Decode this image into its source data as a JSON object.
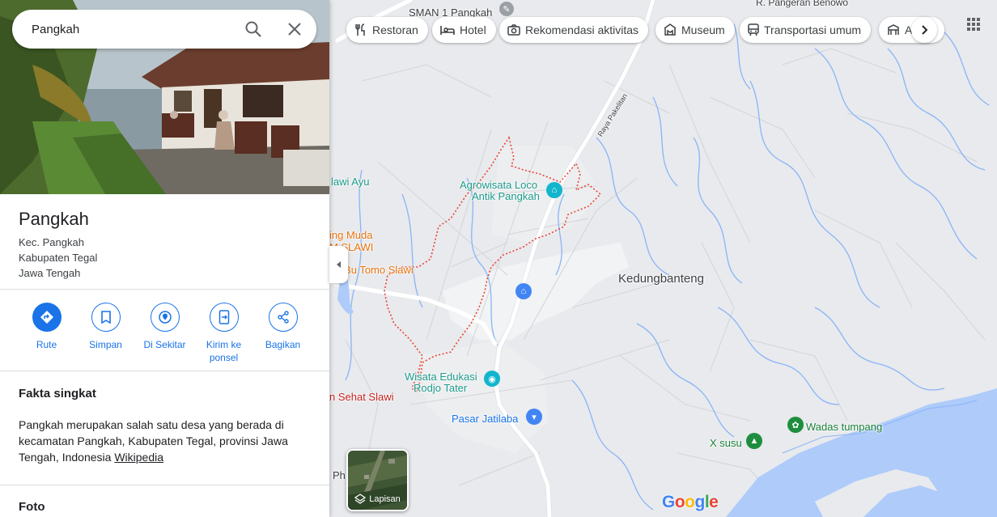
{
  "search": {
    "value": "Pangkah"
  },
  "place": {
    "title": "Pangkah",
    "address_lines": [
      "Kec. Pangkah",
      "Kabupaten Tegal",
      "Jawa Tengah"
    ]
  },
  "actions": [
    {
      "label": "Rute",
      "icon": "directions-icon"
    },
    {
      "label": "Simpan",
      "icon": "bookmark-icon"
    },
    {
      "label": "Di Sekitar",
      "icon": "nearby-icon"
    },
    {
      "label": "Kirim ke ponsel",
      "icon": "send-to-phone-icon"
    },
    {
      "label": "Bagikan",
      "icon": "share-icon"
    }
  ],
  "facts": {
    "title": "Fakta singkat",
    "text": "Pangkah merupakan salah satu desa yang berada di kecamatan Pangkah, Kabupaten Tegal, provinsi Jawa Tengah, Indonesia",
    "source": "Wikipedia"
  },
  "photos": {
    "title": "Foto"
  },
  "chips": [
    {
      "label": "Restoran",
      "icon": "restaurant-icon"
    },
    {
      "label": "Hotel",
      "icon": "hotel-icon"
    },
    {
      "label": "Rekomendasi aktivitas",
      "icon": "camera-icon"
    },
    {
      "label": "Museum",
      "icon": "museum-icon"
    },
    {
      "label": "Transportasi umum",
      "icon": "transit-icon"
    },
    {
      "label": "A",
      "icon": "attraction-icon"
    }
  ],
  "layers": {
    "label": "Lapisan"
  },
  "map_labels": {
    "sman": "SMAN 1 Pangkah",
    "pangeran": "R. Pangeran Benowo",
    "raya": "Raya Pakelitan",
    "slawi_ayu": "lawi Ayu",
    "agrowisata_1": "Agrowisata Loco",
    "agrowisata_2": "Antik Pangkah",
    "ging_muda": "ing Muda",
    "mslawi": "M SLAWI",
    "bu_tomo": "M. Bu Tomo Slawi",
    "kedungbanteng": "Kedungbanteng",
    "wisata_1": "Wisata Edukasi",
    "wisata_2": "Rodjo Tater",
    "sehat": "n Sehat Slawi",
    "pasar": "Pasar Jatilaba",
    "wadas": "Wadas tumpang",
    "xsusu": "X susu",
    "ph": "Ph"
  },
  "branding": {
    "google": "Google"
  },
  "colors": {
    "accent": "#1a73e8",
    "boundary": "#ea4335",
    "water": "#aecbfa"
  }
}
